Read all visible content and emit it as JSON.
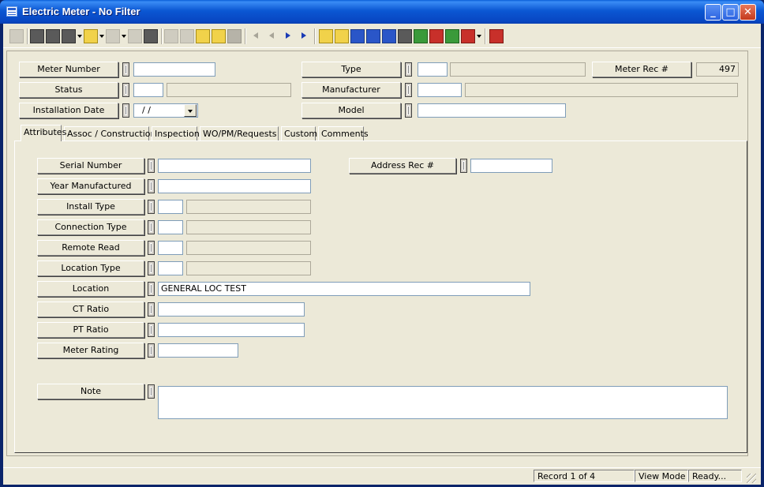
{
  "window": {
    "title": "Electric Meter - No Filter"
  },
  "header_fields": {
    "meter_number": {
      "label": "Meter Number",
      "value": ""
    },
    "status": {
      "label": "Status",
      "code": "",
      "desc": ""
    },
    "installation_date": {
      "label": "Installation Date",
      "value": "/ /"
    },
    "type": {
      "label": "Type",
      "code": "",
      "desc": ""
    },
    "manufacturer": {
      "label": "Manufacturer",
      "code": "",
      "desc": ""
    },
    "model": {
      "label": "Model",
      "value": ""
    },
    "meter_rec": {
      "label": "Meter Rec #",
      "value": "497"
    }
  },
  "tabs": [
    {
      "label": "Attributes",
      "active": true
    },
    {
      "label": "Assoc / Construction"
    },
    {
      "label": "Inspection"
    },
    {
      "label": "WO/PM/Requests"
    },
    {
      "label": "Custom"
    },
    {
      "label": "Comments"
    }
  ],
  "attributes": {
    "serial_number": {
      "label": "Serial Number",
      "value": ""
    },
    "year_manufactured": {
      "label": "Year Manufactured",
      "value": ""
    },
    "install_type": {
      "label": "Install Type",
      "code": "",
      "desc": ""
    },
    "connection_type": {
      "label": "Connection Type",
      "code": "",
      "desc": ""
    },
    "remote_read": {
      "label": "Remote Read",
      "code": "",
      "desc": ""
    },
    "location_type": {
      "label": "Location Type",
      "code": "",
      "desc": ""
    },
    "location": {
      "label": "Location",
      "value": "GENERAL LOC TEST"
    },
    "ct_ratio": {
      "label": "CT Ratio",
      "value": ""
    },
    "pt_ratio": {
      "label": "PT Ratio",
      "value": ""
    },
    "meter_rating": {
      "label": "Meter Rating",
      "value": ""
    },
    "address_rec": {
      "label": "Address Rec #",
      "value": ""
    },
    "note": {
      "label": "Note",
      "value": ""
    }
  },
  "status_bar": {
    "record": "Record 1 of 4",
    "mode": "View Mode",
    "state": "Ready..."
  }
}
